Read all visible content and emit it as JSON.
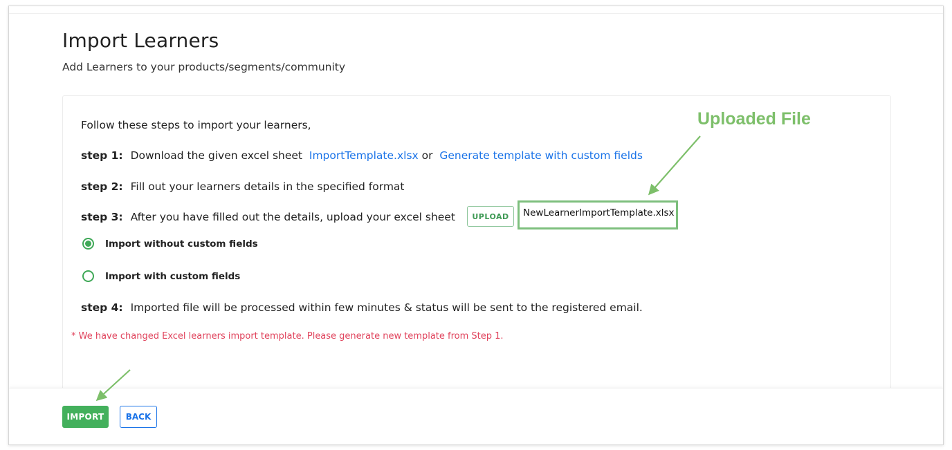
{
  "page": {
    "title": "Import Learners",
    "subtitle": "Add Learners to your products/segments/community"
  },
  "instructions": {
    "intro": "Follow these steps to import your learners,",
    "step1": {
      "label": "step 1:",
      "text": "Download the given excel sheet",
      "template_link": "ImportTemplate.xlsx",
      "or_text": "or",
      "custom_link": "Generate template with custom fields"
    },
    "step2": {
      "label": "step 2:",
      "text": "Fill out your learners details in the specified format"
    },
    "step3": {
      "label": "step 3:",
      "text": "After you have filled out the details, upload your excel sheet",
      "upload_label": "UPLOAD",
      "uploaded_filename": "NewLearnerImportTemplate.xlsx"
    },
    "options": [
      {
        "label": "Import without custom fields",
        "selected": true
      },
      {
        "label": "Import with custom fields",
        "selected": false
      }
    ],
    "step4": {
      "label": "step 4:",
      "text": "Imported file will be processed within few minutes & status will be sent to the registered email."
    },
    "notice": "* We have changed Excel learners import template. Please generate new template from Step 1."
  },
  "footer": {
    "import_label": "IMPORT",
    "back_label": "BACK"
  },
  "annotation": {
    "label": "Uploaded File"
  },
  "colors": {
    "accent_green": "#43b05c",
    "link_blue": "#1a73e8",
    "notice_red": "#e0435c",
    "annotation_green": "#7dbf6a"
  }
}
